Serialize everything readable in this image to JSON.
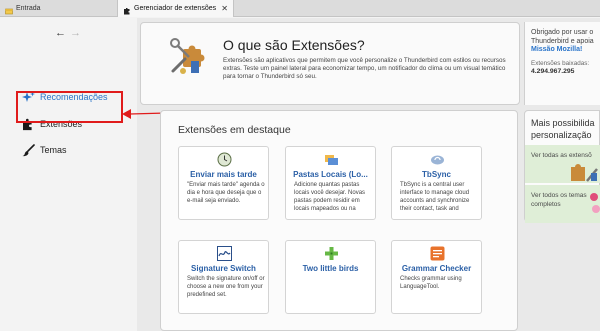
{
  "tabs": [
    {
      "label": "Entrada"
    },
    {
      "label": "Gerenciador de extensões",
      "close": "✕"
    }
  ],
  "nav": {
    "back": "←",
    "forward": "→"
  },
  "sidebar": {
    "items": [
      {
        "label": "Recomendações"
      },
      {
        "label": "Extensões"
      },
      {
        "label": "Temas"
      }
    ]
  },
  "hero": {
    "title": "O que são Extensões?",
    "description": "Extensões são aplicativos que permitem que você personalize o Thunderbird com estilos ou recursos extras. Teste um painel lateral para economizar tempo, um notificador do clima ou um visual temático para tornar o Thunderbird só seu."
  },
  "right_info": {
    "line1": "Obrigado por usar o",
    "line2": "Thunderbird e apoia",
    "link": "Missão Mozilla!",
    "count_label": "Extensões baixadas:",
    "count": "4.294.967.295"
  },
  "featured": {
    "title": "Extensões em destaque",
    "cards": [
      {
        "title": "Enviar mais tarde",
        "desc": "\"Enviar mais tarde\" agenda o dia e hora que deseja que o e-mail seja enviado."
      },
      {
        "title": "Pastas Locais (Lo...",
        "desc": "Adicione quantas pastas locais você desejar. Novas pastas podem residir em locais mapeados ou na"
      },
      {
        "title": "TbSync",
        "desc": "TbSync is a central user interface to manage cloud accounts and synchronize their contact, task and"
      },
      {
        "title": "Signature Switch",
        "desc": "Switch the signature on/off or choose a new one from your predefined set."
      },
      {
        "title": "Two little birds",
        "desc": ""
      },
      {
        "title": "Grammar Checker",
        "desc": "Checks grammar using LanguageTool."
      }
    ]
  },
  "mais": {
    "title_line1": "Mais possibilida",
    "title_line2": "personalização",
    "box1": "Ver todas as extensõ",
    "box2_line1": "Ver todos os temas",
    "box2_line2": "completos"
  },
  "colors": {
    "accent": "#2a74c9",
    "highlight": "#e01b1b",
    "card_title": "#2a5fa6"
  }
}
